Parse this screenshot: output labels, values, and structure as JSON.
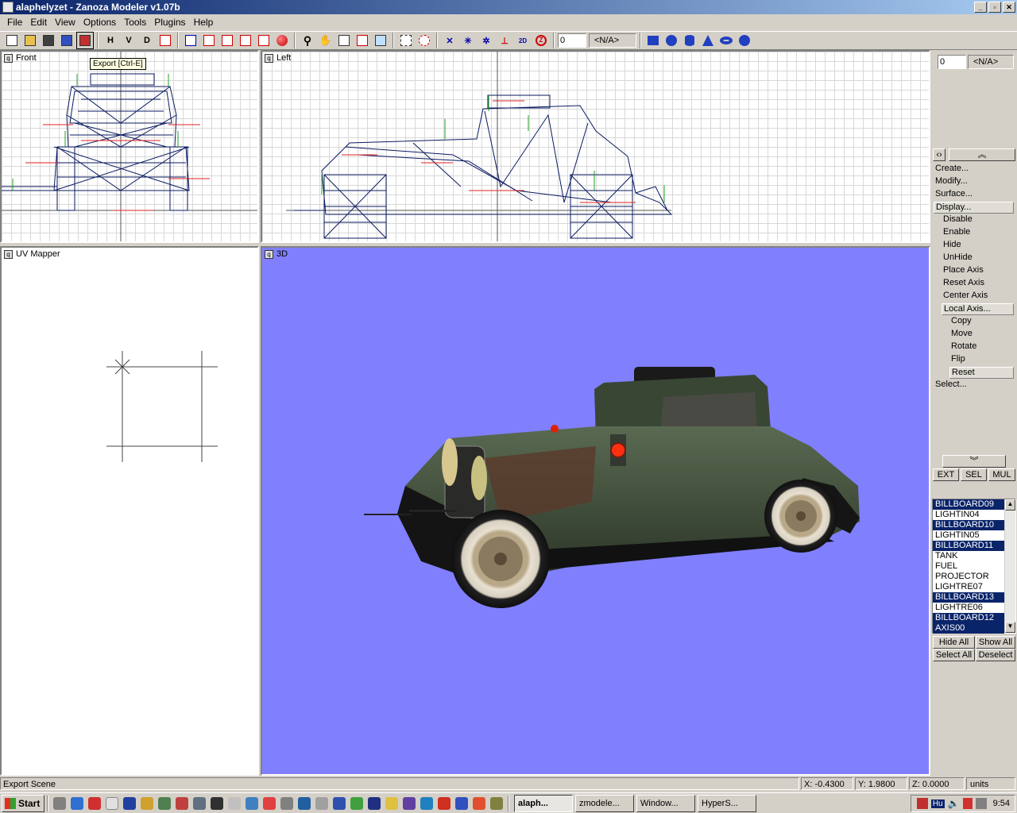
{
  "window": {
    "title": "alaphelyzet - Zanoza Modeler v1.07b",
    "controls": [
      "_",
      "▫",
      "✕"
    ]
  },
  "menu": [
    {
      "label": "File"
    },
    {
      "label": "Edit"
    },
    {
      "label": "View"
    },
    {
      "label": "Options"
    },
    {
      "label": "Tools"
    },
    {
      "label": "Plugins"
    },
    {
      "label": "Help"
    }
  ],
  "toolbar": {
    "view_buttons": [
      "H",
      "V",
      "D"
    ],
    "spinner_value": "0",
    "combo_value": "<N/A>",
    "tooltip": "Export [Ctrl-E]"
  },
  "viewports": {
    "front": {
      "label": "Front"
    },
    "left": {
      "label": "Left"
    },
    "uv": {
      "label": "UV Mapper"
    },
    "view3d": {
      "label": "3D",
      "background": "#8080ff"
    }
  },
  "panel": {
    "spinner_value": "0",
    "combo_value": "<N/A>",
    "menu": [
      {
        "label": "Create...",
        "indent": 0
      },
      {
        "label": "Modify...",
        "indent": 0
      },
      {
        "label": "Surface...",
        "indent": 0
      },
      {
        "label": "Display...",
        "indent": 0,
        "selected": true
      },
      {
        "label": "Disable",
        "indent": 1
      },
      {
        "label": "Enable",
        "indent": 1
      },
      {
        "label": "Hide",
        "indent": 1
      },
      {
        "label": "UnHide",
        "indent": 1
      },
      {
        "label": "Place Axis",
        "indent": 1
      },
      {
        "label": "Reset Axis",
        "indent": 1
      },
      {
        "label": "Center Axis",
        "indent": 1
      },
      {
        "label": "Local Axis...",
        "indent": 1,
        "selected": true
      },
      {
        "label": "Copy",
        "indent": 2
      },
      {
        "label": "Move",
        "indent": 2
      },
      {
        "label": "Rotate",
        "indent": 2
      },
      {
        "label": "Flip",
        "indent": 2
      },
      {
        "label": "Reset",
        "indent": 2,
        "selected": true
      },
      {
        "label": "Select...",
        "indent": 0
      }
    ],
    "mode_buttons": [
      "EXT",
      "SEL",
      "MUL"
    ],
    "objects": [
      {
        "name": "BILLBOARD09",
        "selected": true
      },
      {
        "name": "LIGHTIN04",
        "selected": false
      },
      {
        "name": "BILLBOARD10",
        "selected": true
      },
      {
        "name": "LIGHTIN05",
        "selected": false
      },
      {
        "name": "BILLBOARD11",
        "selected": true
      },
      {
        "name": "TANK",
        "selected": false
      },
      {
        "name": "FUEL",
        "selected": false
      },
      {
        "name": "PROJECTOR",
        "selected": false
      },
      {
        "name": "LIGHTRE07",
        "selected": false
      },
      {
        "name": "BILLBOARD13",
        "selected": true
      },
      {
        "name": "LIGHTRE06",
        "selected": false
      },
      {
        "name": "BILLBOARD12",
        "selected": true
      },
      {
        "name": "AXIS00",
        "selected": true
      }
    ],
    "list_buttons": [
      "Hide All",
      "Show All",
      "Select All",
      "Deselect"
    ]
  },
  "status": {
    "message": "Export Scene",
    "x": "X: -0.4300",
    "y": "Y: 1.9800",
    "z": "Z: 0.0000",
    "units": "units"
  },
  "taskbar": {
    "start": "Start",
    "tasks": [
      {
        "label": "alaph...",
        "active": true
      },
      {
        "label": "zmodele...",
        "active": false
      },
      {
        "label": "Window...",
        "active": false
      },
      {
        "label": "HyperS...",
        "active": false
      }
    ],
    "tray_lang": "Hu",
    "clock": "9:54"
  },
  "colors": {
    "title_start": "#0a246a",
    "title_end": "#a6caf0",
    "selection": "#0a246a",
    "viewport3d": "#8080ff",
    "car_body": "#3d4a36"
  }
}
